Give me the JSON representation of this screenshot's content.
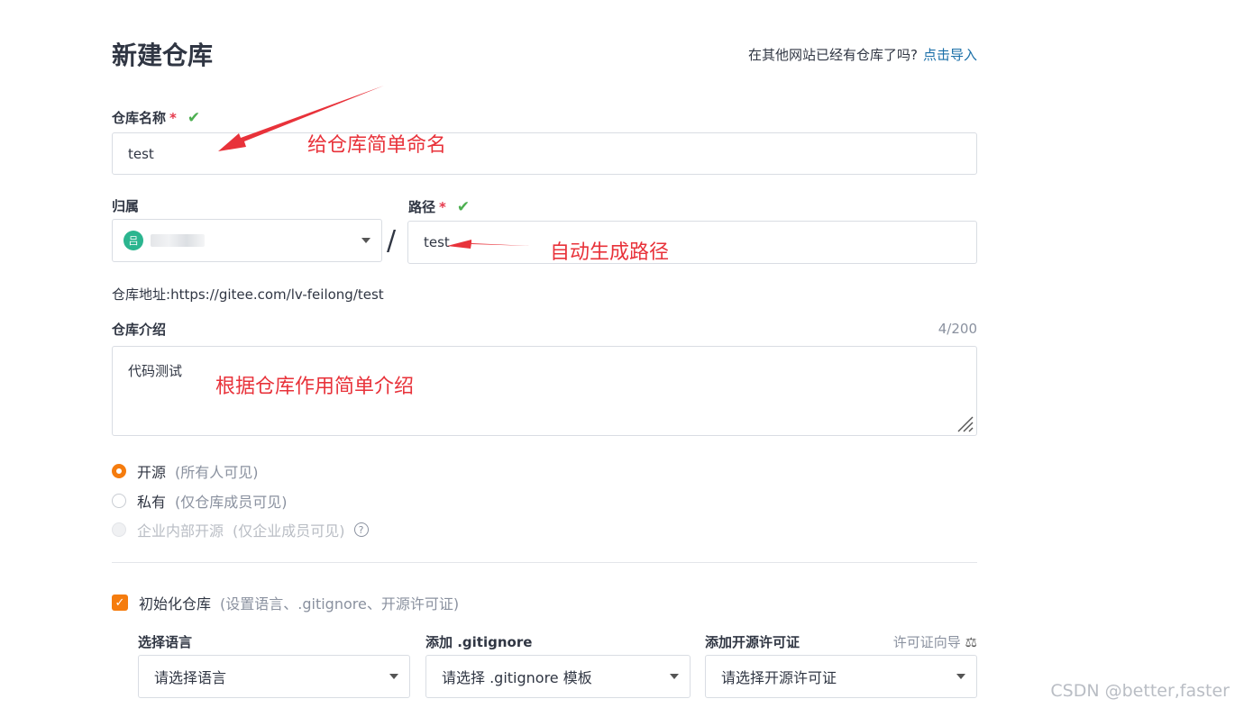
{
  "page": {
    "title": "新建仓库"
  },
  "import": {
    "question": "在其他网站已经有仓库了吗?",
    "link": "点击导入"
  },
  "repo_name": {
    "label": "仓库名称",
    "required": "*",
    "value": "test"
  },
  "owner": {
    "label": "归属",
    "avatar_text": "吕"
  },
  "separator": "/",
  "path": {
    "label": "路径",
    "required": "*",
    "value": "test"
  },
  "repo_address": {
    "label": "仓库地址:",
    "url": "https://gitee.com/lv-feilong/test"
  },
  "description": {
    "label": "仓库介绍",
    "counter": "4/200",
    "value": "代码测试"
  },
  "visibility": {
    "options": [
      {
        "label": "开源",
        "hint": "(所有人可见)",
        "state": "selected"
      },
      {
        "label": "私有",
        "hint": "(仅仓库成员可见)",
        "state": "unselected"
      },
      {
        "label": "企业内部开源",
        "hint": "(仅企业成员可见)",
        "state": "disabled"
      }
    ],
    "help_icon": "?"
  },
  "init": {
    "label": "初始化仓库",
    "hint": "(设置语言、.gitignore、开源许可证)",
    "checked": true
  },
  "language": {
    "label": "选择语言",
    "placeholder": "请选择语言"
  },
  "gitignore": {
    "label": "添加 .gitignore",
    "placeholder": "请选择 .gitignore 模板"
  },
  "license": {
    "label": "添加开源许可证",
    "placeholder": "请选择开源许可证",
    "guide": "许可证向导",
    "guide_icon": "⚖"
  },
  "annotations": {
    "name_note": "给仓库简单命名",
    "path_note": "自动生成路径",
    "desc_note": "根据仓库作用简单介绍"
  },
  "watermark": "CSDN @better,faster",
  "colors": {
    "accent": "#f57c0e",
    "link": "#1a6fa8",
    "annotation": "#e8323a",
    "success": "#4caf50"
  }
}
